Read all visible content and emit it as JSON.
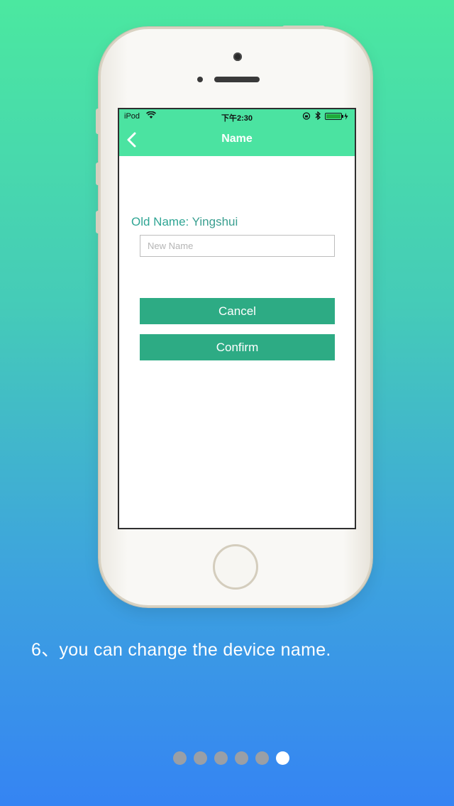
{
  "device": {
    "status": {
      "carrier": "iPod",
      "time": "下午2:30"
    }
  },
  "screen": {
    "nav_title": "Name",
    "old_name_label": "Old Name:",
    "old_name_value": "Yingshui",
    "new_name_placeholder": "New Name",
    "cancel_label": "Cancel",
    "confirm_label": "Confirm"
  },
  "caption": "6、you can change the device name.",
  "pager": {
    "total": 6,
    "active_index": 5
  },
  "colors": {
    "nav_green": "#4be3a1",
    "button_green": "#2dab84",
    "label_teal": "#2fa594",
    "gradient_top": "#4be8a0",
    "gradient_bottom": "#3584f3"
  }
}
